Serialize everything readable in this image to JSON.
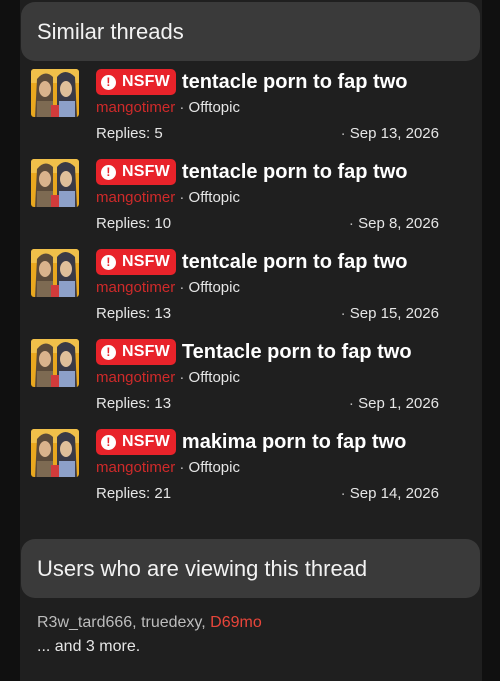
{
  "similar": {
    "header": "Similar threads",
    "badge_label": "NSFW",
    "threads": [
      {
        "title": "tentacle porn to fap two",
        "author": "mangotimer",
        "forum": "Offtopic",
        "replies": "Replies: 5",
        "date": "Sep 13, 2026"
      },
      {
        "title": "tentacle porn to fap two",
        "author": "mangotimer",
        "forum": "Offtopic",
        "replies": "Replies: 10",
        "date": "Sep 8, 2026"
      },
      {
        "title": "tentcale porn to fap two",
        "author": "mangotimer",
        "forum": "Offtopic",
        "replies": "Replies: 13",
        "date": "Sep 15, 2026"
      },
      {
        "title": "Tentacle porn to fap two",
        "author": "mangotimer",
        "forum": "Offtopic",
        "replies": "Replies: 13",
        "date": "Sep 1, 2026"
      },
      {
        "title": "makima porn to fap two",
        "author": "mangotimer",
        "forum": "Offtopic",
        "replies": "Replies: 21",
        "date": "Sep 14, 2026"
      }
    ]
  },
  "viewers": {
    "header": "Users who are viewing this thread",
    "users": [
      "R3w_tard666",
      "truedexy",
      "D69mo"
    ],
    "more": "... and 3 more."
  },
  "colors": {
    "nsfw_badge": "#e8232a",
    "author_link": "#cf2a2a",
    "highlighted_user": "#e8453a"
  },
  "icons": {
    "nsfw_badge": "exclamation-circle-icon",
    "separator": "·"
  }
}
